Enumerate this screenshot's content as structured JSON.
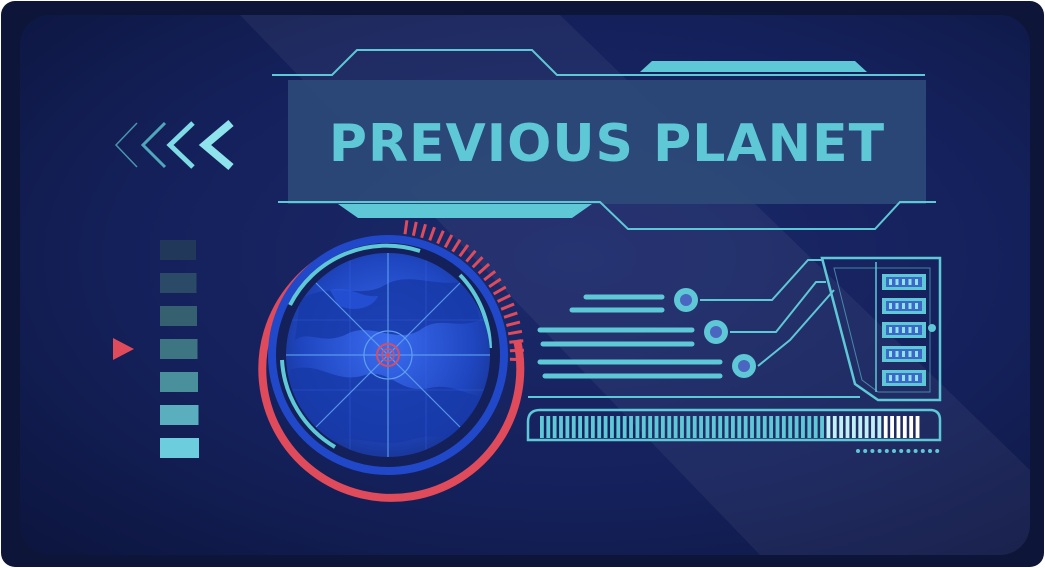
{
  "title": "PREVIOUS PLANET",
  "level_selector": {
    "levels": 7,
    "selected_index": 4
  },
  "progress_bar": {
    "segments": 60,
    "bright_fraction": 0.25
  },
  "colors": {
    "background": "#0f1a3a",
    "panel_inner": "#1a2654",
    "accent_cyan": "#5fc8d6",
    "accent_red": "#e04b5c",
    "radar_blue": "#1f4ac8",
    "title_plate": "#2d4a78"
  },
  "icons": {
    "back": "chevron-left-icon",
    "pointer": "triangle-right-icon",
    "radar": "radar-icon",
    "server": "server-rack-icon"
  }
}
